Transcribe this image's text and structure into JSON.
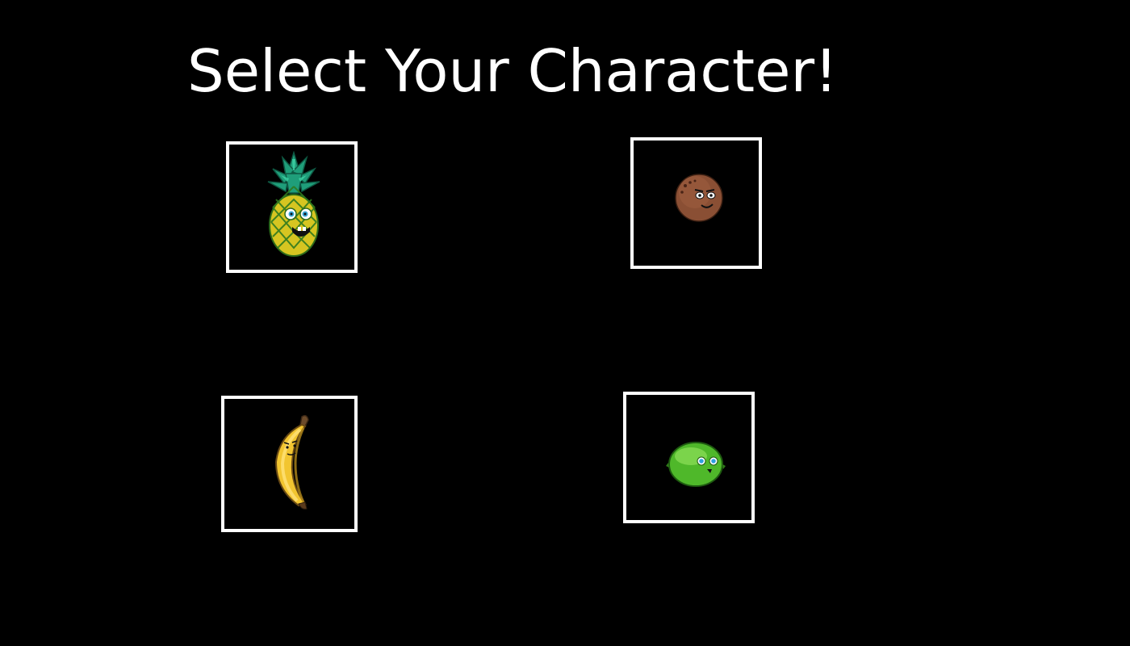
{
  "screen": {
    "title": "Select Your Character!",
    "background_color": "#000000",
    "text_color": "#ffffff",
    "slot_border_color": "#ffffff"
  },
  "characters": [
    {
      "id": "pineapple",
      "icon": "pineapple-icon"
    },
    {
      "id": "coconut",
      "icon": "coconut-icon"
    },
    {
      "id": "banana",
      "icon": "banana-icon"
    },
    {
      "id": "lime",
      "icon": "lime-icon"
    }
  ]
}
